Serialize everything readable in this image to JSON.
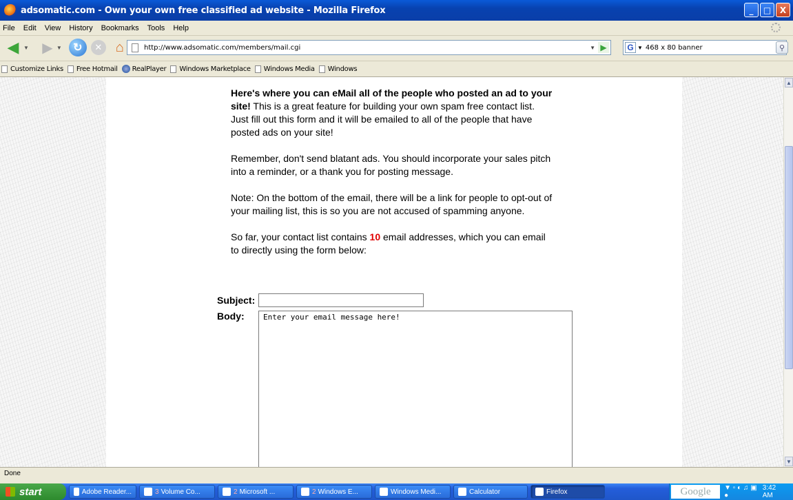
{
  "window": {
    "title": "adsomatic.com - Own your own free classified ad website - Mozilla Firefox",
    "controls": [
      "_",
      "□",
      "X"
    ]
  },
  "menu": [
    "File",
    "Edit",
    "View",
    "History",
    "Bookmarks",
    "Tools",
    "Help"
  ],
  "nav": {
    "url": "http://www.adsomatic.com/members/mail.cgi",
    "search_value": "468 x 80 banner",
    "search_engine_icon": "G"
  },
  "bookmarks": [
    "Customize Links",
    "Free Hotmail",
    "RealPlayer",
    "Windows Marketplace",
    "Windows Media",
    "Windows"
  ],
  "content": {
    "intro_bold": "Here's where you can eMail all of the people who posted an ad to your site!",
    "intro_rest": " This is a great feature for building your own spam free contact list. Just fill out this form and it will be emailed to all of the people that have posted ads on your site!",
    "para2": "Remember, don't send blatant ads. You should incorporate your sales pitch into a reminder, or a thank you for posting message.",
    "para3": "Note: On the bottom of the email, there will be a link for people to opt-out of your mailing list, this is so you are not accused of spamming anyone.",
    "para4_pre": "So far, your contact list contains ",
    "contact_count": "10",
    "para4_post": " email addresses, which you can email to directly using the form below:",
    "subject_label": "Subject:",
    "subject_value": "",
    "body_label": "Body:",
    "body_value": "Enter your email message here!"
  },
  "status": "Done",
  "taskbar": {
    "start": "start",
    "tasks": [
      {
        "count": "",
        "label": "Adobe Reader..."
      },
      {
        "count": "3",
        "label": "Volume Co..."
      },
      {
        "count": "2",
        "label": "Microsoft ..."
      },
      {
        "count": "2",
        "label": "Windows E..."
      },
      {
        "count": "",
        "label": "Windows Medi..."
      },
      {
        "count": "",
        "label": "Calculator"
      },
      {
        "count": "",
        "label": "Firefox"
      }
    ],
    "google": "Google",
    "clock": "3:42 AM"
  }
}
